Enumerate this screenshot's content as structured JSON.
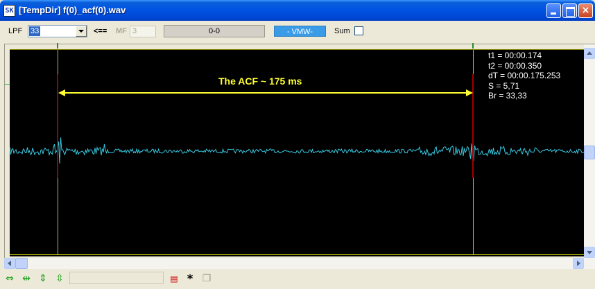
{
  "window": {
    "title": "[TempDir] f(0)_acf(0).wav",
    "app_icon_text": "SK",
    "minimize": "minimize",
    "maximize": "maximize",
    "close": "×"
  },
  "toolbar": {
    "lpf_label": "LPF",
    "lpf_value": "33",
    "arrow_label": "<==",
    "mf_label": "MF",
    "mf_value": "3",
    "counter_value": "0-0",
    "vmw_label": "- VMW-",
    "sum_label": "Sum",
    "sum_checked": false
  },
  "plot": {
    "background": "#000000",
    "signal_color": "#38c8e0",
    "annotation_text": "The ACF ~ 175 ms",
    "annotation_color": "#ffff33",
    "readout": {
      "t1": "t1 = 00:00.174",
      "t2": "t2 = 00:00.350",
      "dT": "dT = 00:00.175.253",
      "S": "S = 5,71",
      "Br": "Br = 33,33"
    }
  },
  "bottom_toolbar": {
    "tools": [
      "expand-horizontal-icon",
      "shrink-horizontal-icon",
      "expand-vertical-icon",
      "shrink-vertical-icon",
      "chart-icon",
      "asterisk-icon",
      "copy-icon"
    ],
    "status_text": ""
  }
}
